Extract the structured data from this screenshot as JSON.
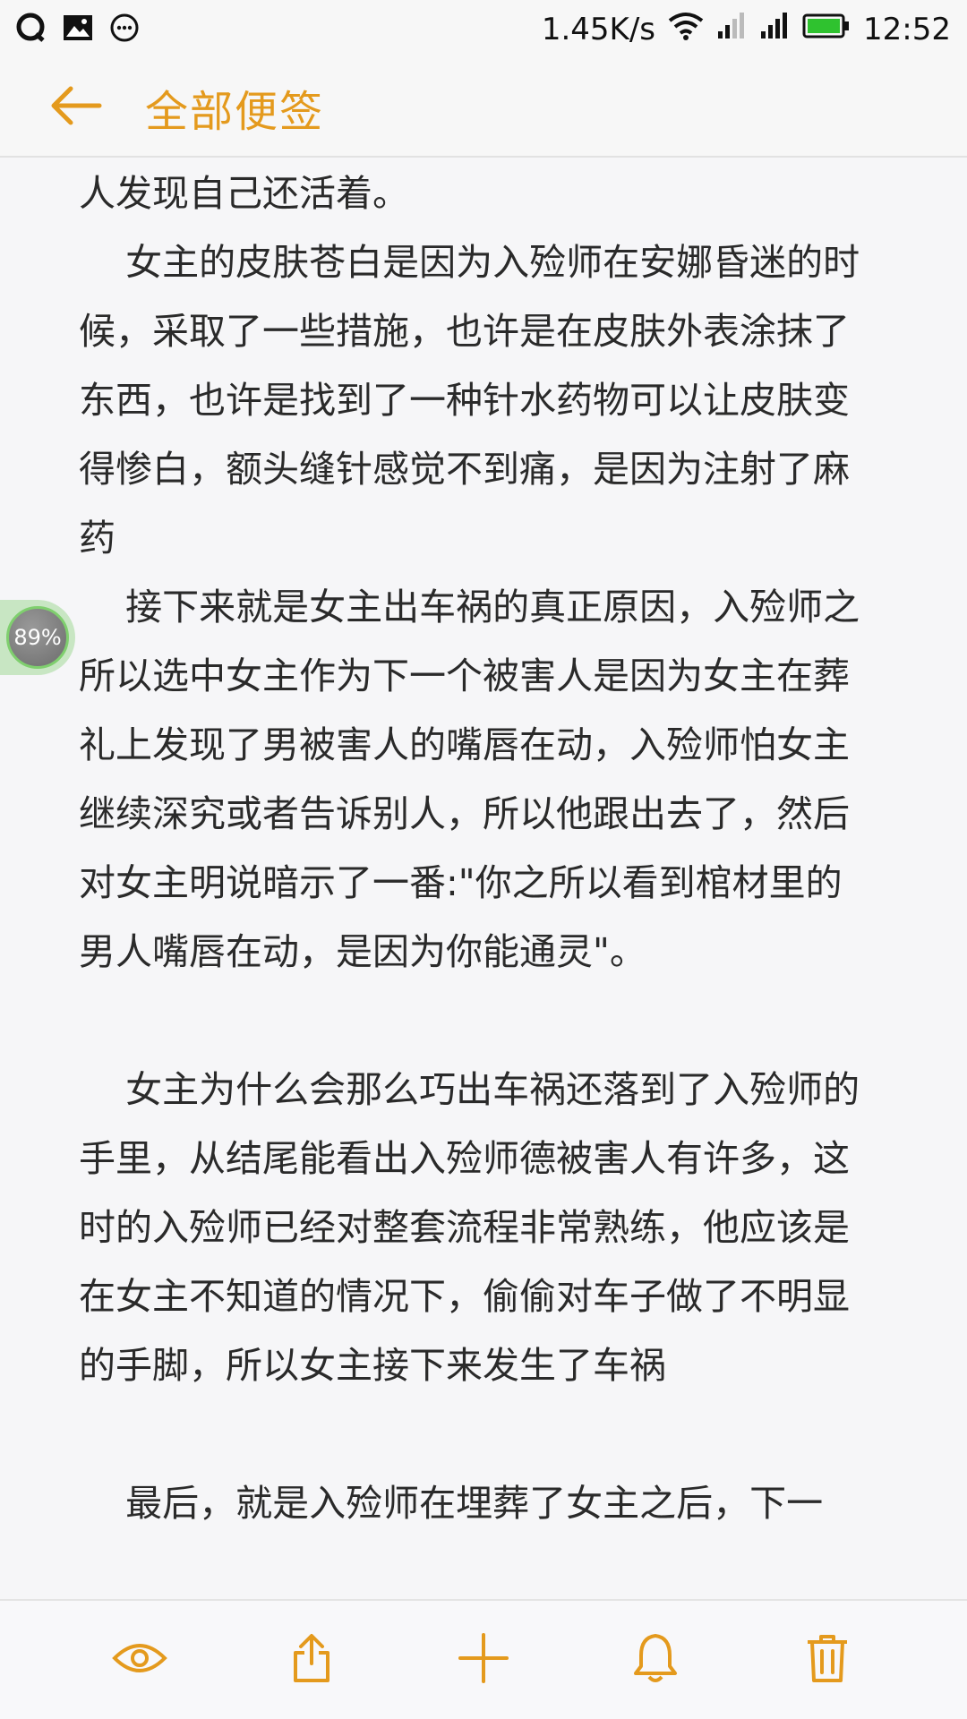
{
  "status_bar": {
    "net_speed": "1.45K/s",
    "time": "12:52",
    "icons": [
      "qq-icon",
      "image-icon",
      "message-icon",
      "wifi-icon",
      "signal-icon",
      "signal-icon-2",
      "battery-icon"
    ]
  },
  "app_bar": {
    "title": "全部便签"
  },
  "note": {
    "paragraphs": [
      "人发现自己还活着。",
      "    女主的皮肤苍白是因为入殓师在安娜昏迷的时候，采取了一些措施，也许是在皮肤外表涂抹了东西，也许是找到了一种针水药物可以让皮肤变得惨白，额头缝针感觉不到痛，是因为注射了麻药",
      "    接下来就是女主出车祸的真正原因，入殓师之所以选中女主作为下一个被害人是因为女主在葬礼上发现了男被害人的嘴唇在动，入殓师怕女主继续深究或者告诉别人，所以他跟出去了，然后对女主明说暗示了一番:\"你之所以看到棺材里的男人嘴唇在动，是因为你能通灵\"。",
      "",
      "    女主为什么会那么巧出车祸还落到了入殓师的手里，从结尾能看出入殓师德被害人有许多，这时的入殓师已经对整套流程非常熟练，他应该是在女主不知道的情况下，偷偷对车子做了不明显的手脚，所以女主接下来发生了车祸",
      "",
      "    最后，就是入殓师在埋葬了女主之后，下一"
    ]
  },
  "float_badge": {
    "label": "89%"
  },
  "toolbar": {
    "accent": "#e49a1d",
    "icons": [
      "eye-icon",
      "share-icon",
      "plus-icon",
      "bell-icon",
      "trash-icon"
    ]
  }
}
